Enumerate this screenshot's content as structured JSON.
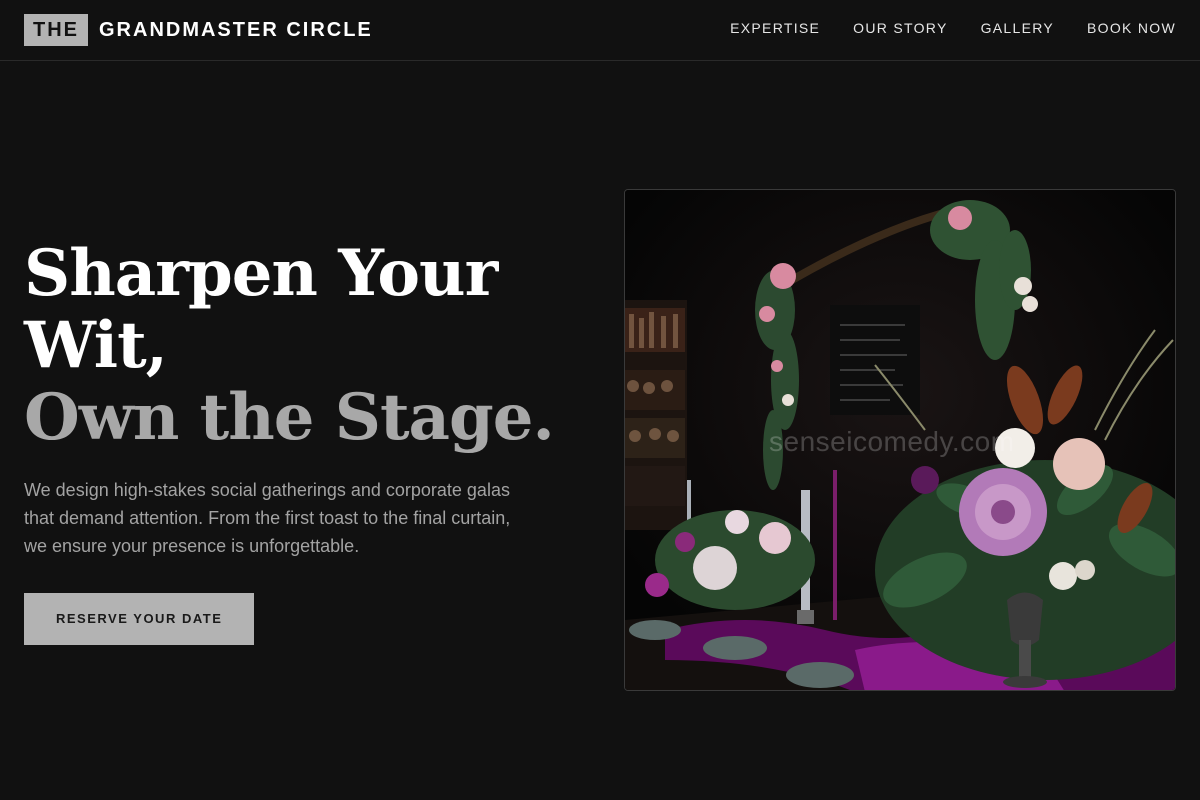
{
  "brand": {
    "badge": "THE",
    "name": "GRANDMASTER CIRCLE"
  },
  "nav": {
    "items": [
      "EXPERTISE",
      "OUR STORY",
      "GALLERY",
      "BOOK NOW"
    ]
  },
  "hero": {
    "headline_line1": "Sharpen Your",
    "headline_line2": "Wit,",
    "headline_line3": "Own the Stage.",
    "description": "We design high-stakes social gatherings and corporate galas that demand attention. From the first toast to the final curtain, we ensure your presence is unforgettable.",
    "cta_label": "RESERVE YOUR DATE"
  },
  "photo": {
    "watermark": "senseicomedy.com"
  },
  "colors": {
    "background": "#111111",
    "accent_gray": "#b3b3b3",
    "muted_text": "#a3a3a3",
    "flower_purple": "#8a1a8a"
  }
}
